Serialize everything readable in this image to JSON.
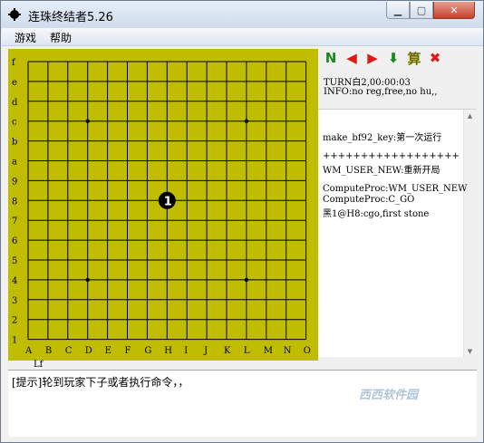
{
  "window": {
    "title": "连珠终结者5.26"
  },
  "menu": {
    "items": [
      "游戏",
      "帮助"
    ]
  },
  "toolbar": {
    "buttons": [
      {
        "name": "new-game-icon",
        "glyph": "N",
        "color": "#1a8a1a"
      },
      {
        "name": "undo-icon",
        "glyph": "◀",
        "color": "#e01818"
      },
      {
        "name": "redo-icon",
        "glyph": "▶",
        "color": "#e01818"
      },
      {
        "name": "download-icon",
        "glyph": "⬇",
        "color": "#1a8a1a"
      },
      {
        "name": "compute-icon",
        "glyph": "算",
        "color": "#6c6c00"
      },
      {
        "name": "cancel-icon",
        "glyph": "✖",
        "color": "#e01818"
      }
    ]
  },
  "status": {
    "turn": "TURN白2,00:00:03",
    "info": "INFO:no reg,free,no hu,,"
  },
  "log": {
    "lines": [
      "make_bf92_key:第一次运行",
      "",
      "++++++++++++++++++",
      "WM_USER_NEW:重新开局",
      "",
      "ComputeProc:WM_USER_NEW",
      "ComputeProc:C_GO",
      "黑1@H8:cgo,first stone"
    ]
  },
  "board": {
    "size": 15,
    "row_labels": [
      "f",
      "e",
      "d",
      "c",
      "b",
      "a",
      "9",
      "8",
      "7",
      "6",
      "5",
      "4",
      "3",
      "2",
      "1"
    ],
    "col_labels": [
      "A",
      "B",
      "C",
      "D",
      "E",
      "F",
      "G",
      "H",
      "I",
      "J",
      "K",
      "L",
      "M",
      "N",
      "O"
    ],
    "star_points": [
      "D12",
      "L12",
      "H8",
      "D4",
      "L4"
    ],
    "stones": [
      {
        "pos": "H8",
        "color": "black",
        "label": "1"
      }
    ],
    "background": "#c0bd00"
  },
  "footer_label": "Lf",
  "prompt": "[提示]轮到玩家下子或者执行命令，，",
  "watermark": "西西软件园"
}
